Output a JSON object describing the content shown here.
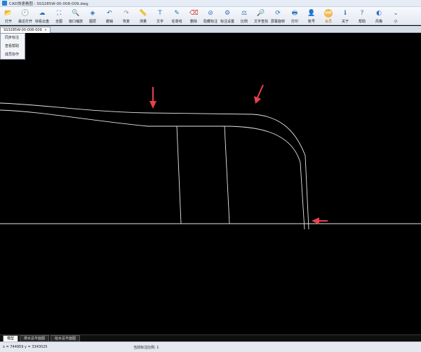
{
  "window": {
    "title": "CAD快速看图 - SS3285W-00-008-009.dwg"
  },
  "toolbar": [
    {
      "name": "open-button",
      "icon": "folder-icon",
      "glyph": "📂",
      "label": "打开"
    },
    {
      "name": "recent-open-button",
      "icon": "clock-icon",
      "glyph": "🕘",
      "label": "最近打开"
    },
    {
      "name": "quick-cloud-button",
      "icon": "cloud-icon",
      "glyph": "☁",
      "label": "快看云盘"
    },
    {
      "name": "full-view-button",
      "icon": "fullscreen-icon",
      "glyph": "⛶",
      "label": "全图"
    },
    {
      "name": "window-zoom-button",
      "icon": "magnifier-icon",
      "glyph": "🔍",
      "label": "窗口缩放"
    },
    {
      "name": "layers-button",
      "icon": "layers-icon",
      "glyph": "◈",
      "label": "图层"
    },
    {
      "name": "undo-button",
      "icon": "undo-icon",
      "glyph": "↶",
      "label": "撤销"
    },
    {
      "name": "redo-button",
      "icon": "redo-icon",
      "glyph": "↷",
      "label": "恢复"
    },
    {
      "name": "measure-button",
      "icon": "ruler-icon",
      "glyph": "📏",
      "label": "测量"
    },
    {
      "name": "text-button",
      "icon": "text-icon",
      "glyph": "T",
      "label": "文字"
    },
    {
      "name": "freehand-line-button",
      "icon": "pencil-icon",
      "glyph": "✎",
      "label": "任意线"
    },
    {
      "name": "delete-button",
      "icon": "eraser-icon",
      "glyph": "⌫",
      "label": "删除"
    },
    {
      "name": "hide-annotation-button",
      "icon": "eye-off-icon",
      "glyph": "⊘",
      "label": "隐藏标注"
    },
    {
      "name": "annotation-settings-button",
      "icon": "settings-icon",
      "glyph": "⚙",
      "label": "标注设置"
    },
    {
      "name": "scale-button",
      "icon": "scale-icon",
      "glyph": "⚖",
      "label": "比例"
    },
    {
      "name": "text-search-button",
      "icon": "search-text-icon",
      "glyph": "🔎",
      "label": "文字查找"
    },
    {
      "name": "rotate-screen-button",
      "icon": "rotate-icon",
      "glyph": "⟳",
      "label": "屏幕旋转"
    },
    {
      "name": "print-button",
      "icon": "printer-icon",
      "glyph": "🖶",
      "label": "打印"
    },
    {
      "name": "account-button",
      "icon": "user-icon",
      "glyph": "👤",
      "label": "账号"
    },
    {
      "name": "vip-button",
      "icon": "vip-icon",
      "glyph": "VIP",
      "label": "会员",
      "vip": true
    },
    {
      "name": "about-button",
      "icon": "info-icon",
      "glyph": "ℹ",
      "label": "关于"
    },
    {
      "name": "help-button",
      "icon": "help-icon",
      "glyph": "?",
      "label": "帮助"
    },
    {
      "name": "style-button",
      "icon": "palette-icon",
      "glyph": "◐",
      "label": "风格"
    },
    {
      "name": "minimize-button",
      "icon": "minimize-icon",
      "glyph": "⌄",
      "label": "小"
    }
  ],
  "document_tab": {
    "label": "SS3285W-00-008-009",
    "close": "×"
  },
  "context_menu": [
    "同步标注",
    "查看帮助",
    "成员协作"
  ],
  "sheet_tabs": [
    "模型",
    "排水总平面图",
    "给水总平面图"
  ],
  "status": {
    "coords": "x = 744959  y = 3343025",
    "scale": "当前标注比例: 1"
  },
  "colors": {
    "arrow": "#e8414a",
    "line": "#e6e6e6",
    "background": "#000000"
  }
}
